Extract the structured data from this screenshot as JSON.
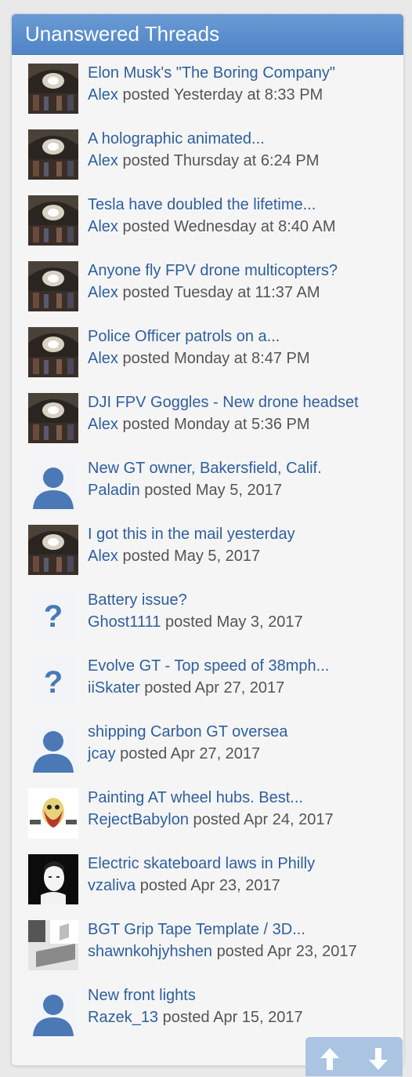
{
  "header": {
    "title": "Unanswered Threads"
  },
  "threads": [
    {
      "title": "Elon Musk's \"The Boring Company\"",
      "user": "Alex",
      "posted": "posted Yesterday at 8:33 PM",
      "avatar": "tunnel"
    },
    {
      "title": "A holographic animated...",
      "user": "Alex",
      "posted": "posted Thursday at 6:24 PM",
      "avatar": "tunnel"
    },
    {
      "title": "Tesla have doubled the lifetime...",
      "user": "Alex",
      "posted": "posted Wednesday at 8:40 AM",
      "avatar": "tunnel"
    },
    {
      "title": "Anyone fly FPV drone multicopters?",
      "user": "Alex",
      "posted": "posted Tuesday at 11:37 AM",
      "avatar": "tunnel"
    },
    {
      "title": "Police Officer patrols on a...",
      "user": "Alex",
      "posted": "posted Monday at 8:47 PM",
      "avatar": "tunnel"
    },
    {
      "title": "DJI FPV Goggles - New drone headset",
      "user": "Alex",
      "posted": "posted Monday at 5:36 PM",
      "avatar": "tunnel"
    },
    {
      "title": "New GT owner, Bakersfield, Calif.",
      "user": "Paladin",
      "posted": "posted May 5, 2017",
      "avatar": "default-person"
    },
    {
      "title": "I got this in the mail yesterday",
      "user": "Alex",
      "posted": "posted May 5, 2017",
      "avatar": "tunnel"
    },
    {
      "title": "Battery issue?",
      "user": "Ghost1111",
      "posted": "posted May 3, 2017",
      "avatar": "question"
    },
    {
      "title": "Evolve GT - Top speed of 38mph...",
      "user": "iiSkater",
      "posted": "posted Apr 27, 2017",
      "avatar": "question"
    },
    {
      "title": "shipping Carbon GT oversea",
      "user": "jcay",
      "posted": "posted Apr 27, 2017",
      "avatar": "default-person"
    },
    {
      "title": "Painting AT wheel hubs. Best...",
      "user": "RejectBabylon",
      "posted": "posted Apr 24, 2017",
      "avatar": "cartoon"
    },
    {
      "title": "Electric skateboard laws in Philly",
      "user": "vzaliva",
      "posted": "posted Apr 23, 2017",
      "avatar": "sketch-man"
    },
    {
      "title": "BGT Grip Tape Template / 3D...",
      "user": "shawnkohjyhshen",
      "posted": "posted Apr 23, 2017",
      "avatar": "photo-corner"
    },
    {
      "title": "New front lights",
      "user": "Razek_13",
      "posted": "posted Apr 15, 2017",
      "avatar": "default-person"
    }
  ],
  "scroll": {
    "up_icon": "arrow-up-icon",
    "down_icon": "arrow-down-icon"
  },
  "colors": {
    "header": "#5a8dcc",
    "link": "#2f5f9d",
    "meta": "#555555"
  }
}
